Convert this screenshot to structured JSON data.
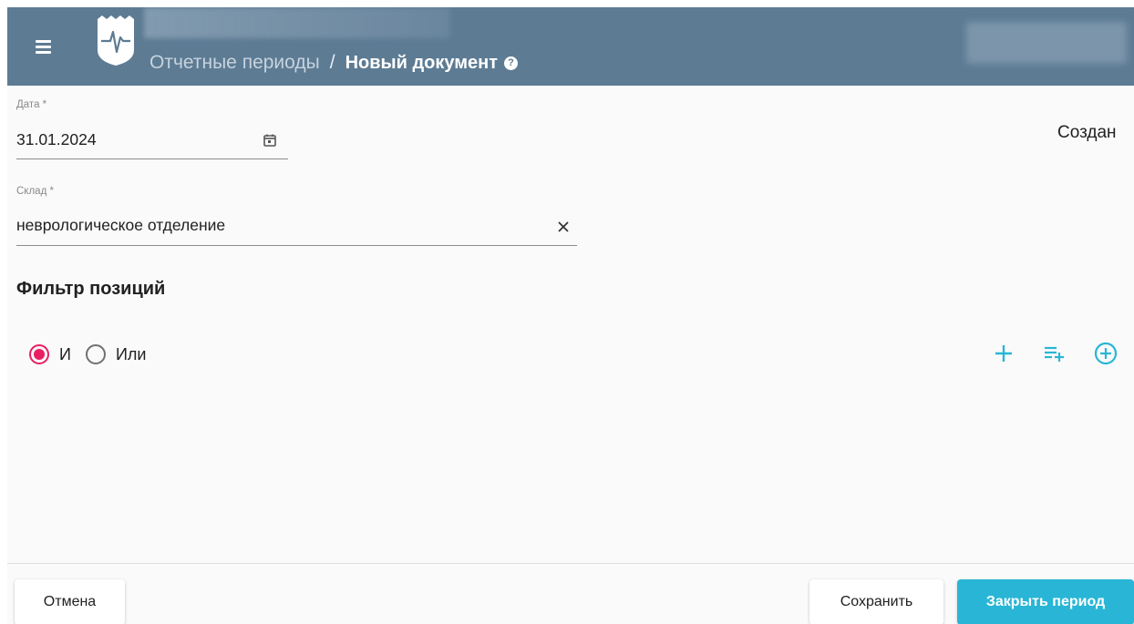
{
  "header": {
    "breadcrumb_parent": "Отчетные периоды",
    "breadcrumb_separator": "/",
    "breadcrumb_current": "Новый документ",
    "help_glyph": "?",
    "background_color": "#5d7b93"
  },
  "form": {
    "date": {
      "label": "Дата *",
      "value": "31.01.2024"
    },
    "sklad": {
      "label": "Склад *",
      "value": "неврологическое отделение"
    },
    "created_label": "Создан"
  },
  "filter": {
    "title": "Фильтр позиций",
    "radio_and": {
      "label": "И",
      "checked": true
    },
    "radio_or": {
      "label": "Или",
      "checked": false
    },
    "actions": [
      "plus-icon",
      "playlist-add-icon",
      "add-circle-icon"
    ],
    "accent_color": "#29b6d6",
    "radio_checked_color": "#e91e63"
  },
  "footer": {
    "cancel_label": "Отмена",
    "save_label": "Сохранить",
    "close_period_label": "Закрыть период"
  }
}
